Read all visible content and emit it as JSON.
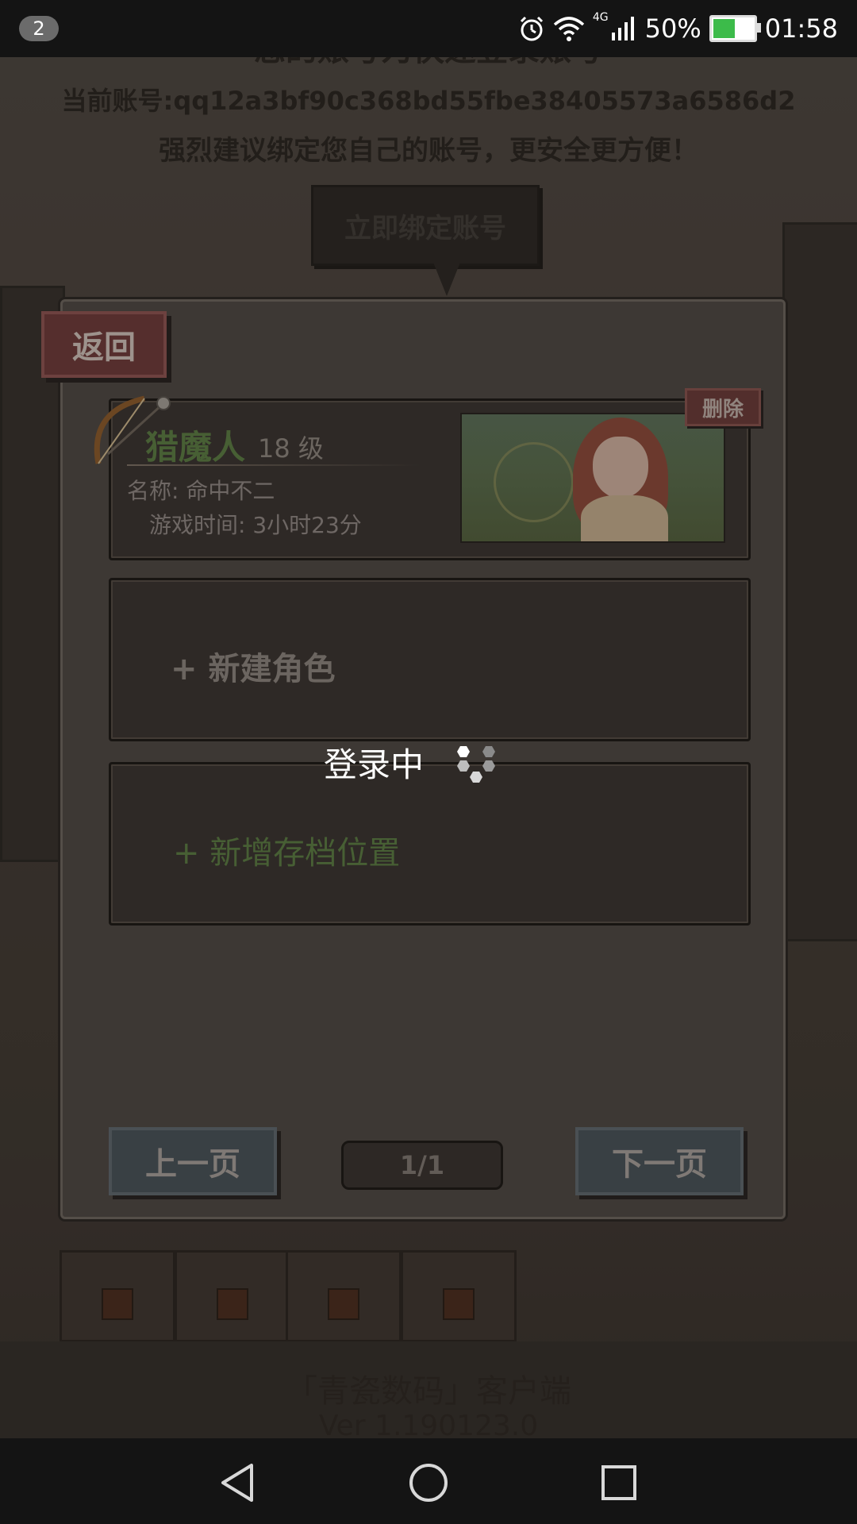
{
  "status_bar": {
    "notification_count": "2",
    "network": "4G",
    "battery_percent": "50%",
    "battery_level": 0.5,
    "time": "01:58",
    "icons": [
      "alarm-icon",
      "wifi-icon",
      "signal-icon",
      "battery-icon"
    ]
  },
  "background": {
    "account_notice_title": "您的账号为快速登录账号",
    "current_account": "当前账号:qq12a3bf90c368bd55fbe38405573a6586d2",
    "bind_advice": "强烈建议绑定您自己的账号，更安全更方便！",
    "bind_button_label": "立即绑定账号",
    "client_title": "「青瓷数码」客户端",
    "version": "Ver 1.190123.0"
  },
  "dialog": {
    "back_label": "返回",
    "save_slot": {
      "class_name": "猎魔人",
      "level": "18 级",
      "character_name": "名称:  命中不二",
      "play_time": "游戏时间:  3小时23分",
      "delete_label": "删除"
    },
    "new_character_label": "+ 新建角色",
    "new_slot_label": "+ 新增存档位置",
    "prev_page_label": "上一页",
    "page_indicator": "1/1",
    "next_page_label": "下一页"
  },
  "loading": {
    "text": "登录中"
  },
  "colors": {
    "accent_green": "#5c7a43",
    "delete_red": "#6a3c39",
    "page_button_blue": "#4a5258"
  }
}
